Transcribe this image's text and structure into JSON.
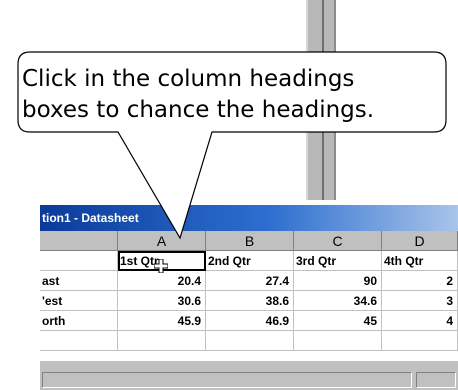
{
  "callout": {
    "line1": "Click in the column headings",
    "line2": "boxes to chance the headings."
  },
  "window": {
    "title": "tion1 - Datasheet"
  },
  "datasheet": {
    "column_letters": [
      "A",
      "B",
      "C",
      "D"
    ],
    "headings": [
      "1st Qtr",
      "2nd Qtr",
      "3rd Qtr",
      "4th Qtr"
    ],
    "rows": [
      {
        "label": "ast",
        "values": [
          "20.4",
          "27.4",
          "90",
          "2"
        ]
      },
      {
        "label": "'est",
        "values": [
          "30.6",
          "38.6",
          "34.6",
          "3"
        ]
      },
      {
        "label": "orth",
        "values": [
          "45.9",
          "46.9",
          "45",
          "4"
        ]
      }
    ]
  },
  "colors": {
    "titlebar_start": "#0b3b9a",
    "titlebar_end": "#a9c4ea",
    "grid_header": "#c0c0c0"
  },
  "icons": {
    "cursor": "plus-cross-cursor-icon"
  }
}
